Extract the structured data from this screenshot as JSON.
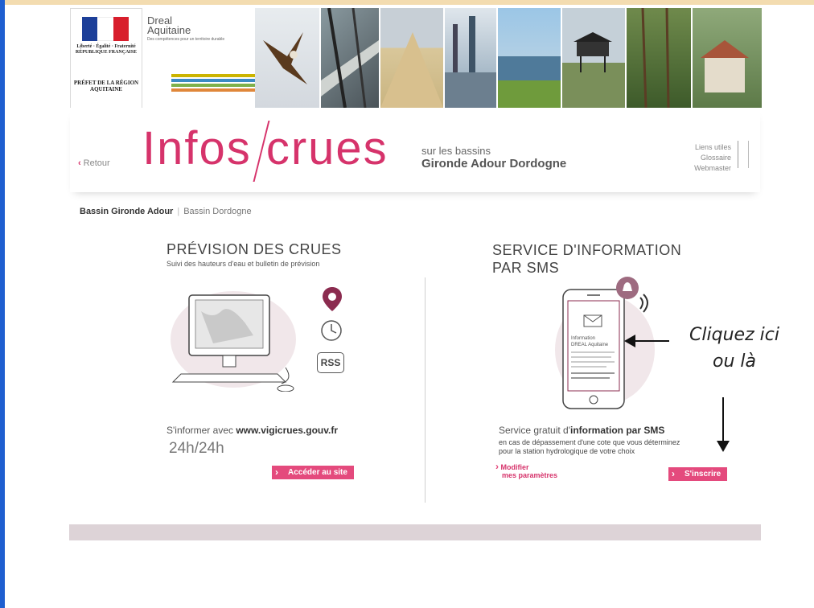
{
  "header": {
    "republique_text": "Liberté · Égalité · Fraternité RÉPUBLIQUE FRANÇAISE",
    "prefet_text": "PRÉFET DE LA RÉGION AQUITAINE",
    "dreal_name": "Dreal Aquitaine",
    "dreal_tagline": "Des compétences pour un territoire durable"
  },
  "titlebar": {
    "back_label": "Retour",
    "title": "Infos crues",
    "subtitle_line1": "sur les bassins",
    "subtitle_line2": "Gironde Adour Dordogne",
    "links": [
      "Liens utiles",
      "Glossaire",
      "Webmaster"
    ]
  },
  "basins": {
    "active": "Bassin Gironde Adour",
    "separator": "|",
    "other": "Bassin Dordogne"
  },
  "left_panel": {
    "title": "PRÉVISION DES CRUES",
    "subtitle": "Suivi des hauteurs d'eau et bulletin de prévision",
    "rss_label": "RSS",
    "inform_prefix": "S'informer avec",
    "inform_site": "www.vigicrues.gouv.fr",
    "hours": "24h/24h",
    "button_label": "Accéder au site"
  },
  "right_panel": {
    "title_line1": "SERVICE D'INFORMATION",
    "title_line2": "PAR SMS",
    "phone_text1": "Information",
    "phone_text2": "DREAL Aquitaine",
    "desc_prefix": "Service gratuit d'",
    "desc_bold": "information par SMS",
    "desc_line2": "en cas de dépassement d'une cote que vous déterminez",
    "desc_line3": "pour la station hydrologique de votre choix",
    "modify_line1": "Modifier",
    "modify_line2": "mes paramètres",
    "button_label": "S'inscrire"
  },
  "annotation": {
    "line1": "Cliquez ici",
    "line2": "ou là"
  },
  "colors": {
    "accent": "#d6336b",
    "button": "#e44a7d",
    "border_blue": "#1f5fd0"
  }
}
